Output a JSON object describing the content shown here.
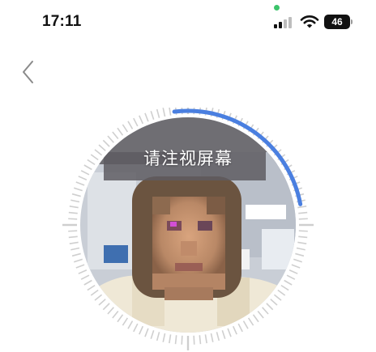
{
  "status_bar": {
    "time": "17:11",
    "battery_level": "46",
    "privacy_dot_color": "#3cc46b"
  },
  "nav": {
    "back_icon": "chevron-left-icon"
  },
  "face_scan": {
    "prompt": "请注视屏幕",
    "progress_fraction": 0.24,
    "progress_color": "#4a7fe0",
    "tick_color": "#cfcfcf"
  }
}
